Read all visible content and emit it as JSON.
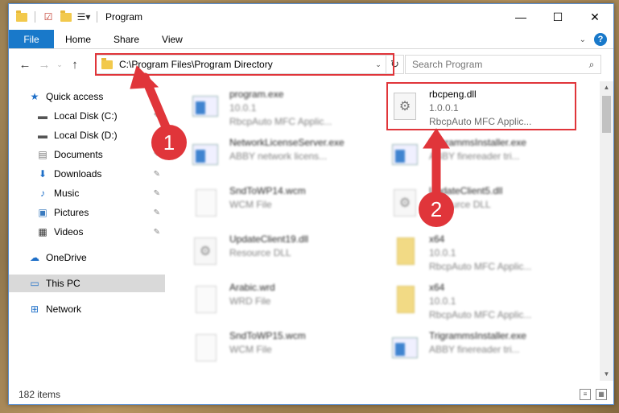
{
  "window": {
    "title": "Program",
    "controls": {
      "minimize": "—",
      "maximize": "☐",
      "close": "✕"
    }
  },
  "ribbon": {
    "file": "File",
    "tabs": [
      "Home",
      "Share",
      "View"
    ],
    "help": "?"
  },
  "nav": {
    "address": "C:\\Program Files\\Program Directory",
    "search_placeholder": "Search Program"
  },
  "sidebar": {
    "items": [
      {
        "label": "Quick access",
        "icon": "star-icon",
        "pinned": false
      },
      {
        "label": "Local Disk (C:)",
        "icon": "drive-icon",
        "pinned": true
      },
      {
        "label": "Local Disk (D:)",
        "icon": "drive-icon",
        "pinned": true
      },
      {
        "label": "Documents",
        "icon": "documents-icon",
        "pinned": true
      },
      {
        "label": "Downloads",
        "icon": "download-icon",
        "pinned": true
      },
      {
        "label": "Music",
        "icon": "music-icon",
        "pinned": true
      },
      {
        "label": "Pictures",
        "icon": "pictures-icon",
        "pinned": true
      },
      {
        "label": "Videos",
        "icon": "videos-icon",
        "pinned": true
      },
      {
        "label": "OneDrive",
        "icon": "cloud-icon",
        "pinned": false
      },
      {
        "label": "This PC",
        "icon": "computer-icon",
        "pinned": false,
        "selected": true
      },
      {
        "label": "Network",
        "icon": "network-icon",
        "pinned": false
      }
    ]
  },
  "files": [
    {
      "name": "program.exe",
      "line2": "10.0.1",
      "line3": "RbcpAuto MFC Applic...",
      "type": "exe"
    },
    {
      "name": "rbcpeng.dll",
      "line2": "1.0.0.1",
      "line3": "RbcpAuto MFC Applic...",
      "type": "dll"
    },
    {
      "name": "NetworkLicenseServer.exe",
      "line2": "ABBY network licens...",
      "line3": "",
      "type": "exe"
    },
    {
      "name": "TrigrammsInstaller.exe",
      "line2": "ABBY finereader tri...",
      "line3": "",
      "type": "exe"
    },
    {
      "name": "SndToWP14.wcm",
      "line2": "WCM File",
      "line3": "",
      "type": "doc"
    },
    {
      "name": "UpdateClient5.dll",
      "line2": "Resource DLL",
      "line3": "",
      "type": "dll"
    },
    {
      "name": "UpdateClient19.dll",
      "line2": "Resource DLL",
      "line3": "",
      "type": "dll"
    },
    {
      "name": "x64",
      "line2": "10.0.1",
      "line3": "RbcpAuto MFC Applic...",
      "type": "zip"
    },
    {
      "name": "Arabic.wrd",
      "line2": "WRD File",
      "line3": "",
      "type": "doc"
    },
    {
      "name": "x64",
      "line2": "10.0.1",
      "line3": "RbcpAuto MFC Applic...",
      "type": "zip"
    },
    {
      "name": "SndToWP15.wcm",
      "line2": "WCM File",
      "line3": "",
      "type": "doc"
    },
    {
      "name": "TrigrammsInstaller.exe",
      "line2": "ABBY finereader tri...",
      "line3": "",
      "type": "exe"
    }
  ],
  "status": {
    "items": "182 items"
  },
  "annotations": {
    "badge1": "1",
    "badge2": "2",
    "color": "#e0353a"
  }
}
